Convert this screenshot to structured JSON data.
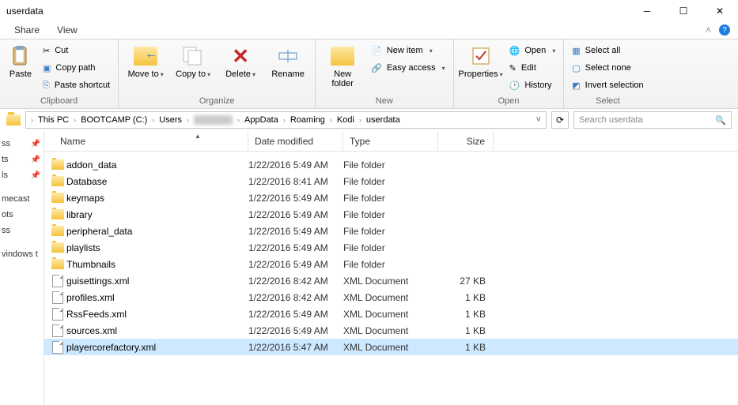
{
  "window": {
    "title": "userdata"
  },
  "tabs": {
    "share": "Share",
    "view": "View"
  },
  "ribbon": {
    "clipboard": {
      "label": "Clipboard",
      "paste": "Paste",
      "cut": "Cut",
      "copy_path": "Copy path",
      "paste_shortcut": "Paste shortcut"
    },
    "organize": {
      "label": "Organize",
      "move_to": "Move\nto",
      "copy_to": "Copy\nto",
      "delete": "Delete",
      "rename": "Rename"
    },
    "new": {
      "label": "New",
      "new_folder": "New\nfolder",
      "new_item": "New item",
      "easy_access": "Easy access"
    },
    "open": {
      "label": "Open",
      "properties": "Properties",
      "open": "Open",
      "edit": "Edit",
      "history": "History"
    },
    "select": {
      "label": "Select",
      "select_all": "Select all",
      "select_none": "Select none",
      "invert": "Invert selection"
    }
  },
  "breadcrumb": {
    "items": [
      "This PC",
      "BOOTCAMP (C:)",
      "Users",
      "████",
      "AppData",
      "Roaming",
      "Kodi",
      "userdata"
    ]
  },
  "search": {
    "placeholder": "Search userdata"
  },
  "columns": {
    "name": "Name",
    "date": "Date modified",
    "type": "Type",
    "size": "Size"
  },
  "nav": {
    "items": [
      "ss",
      "ts",
      "ls",
      "",
      "mecast",
      "ots",
      "ss",
      "",
      "vindows t"
    ]
  },
  "files": [
    {
      "name": "addon_data",
      "date": "1/22/2016 5:49 AM",
      "type": "File folder",
      "size": "",
      "icon": "folder"
    },
    {
      "name": "Database",
      "date": "1/22/2016 8:41 AM",
      "type": "File folder",
      "size": "",
      "icon": "folder"
    },
    {
      "name": "keymaps",
      "date": "1/22/2016 5:49 AM",
      "type": "File folder",
      "size": "",
      "icon": "folder"
    },
    {
      "name": "library",
      "date": "1/22/2016 5:49 AM",
      "type": "File folder",
      "size": "",
      "icon": "folder"
    },
    {
      "name": "peripheral_data",
      "date": "1/22/2016 5:49 AM",
      "type": "File folder",
      "size": "",
      "icon": "folder"
    },
    {
      "name": "playlists",
      "date": "1/22/2016 5:49 AM",
      "type": "File folder",
      "size": "",
      "icon": "folder"
    },
    {
      "name": "Thumbnails",
      "date": "1/22/2016 5:49 AM",
      "type": "File folder",
      "size": "",
      "icon": "folder"
    },
    {
      "name": "guisettings.xml",
      "date": "1/22/2016 8:42 AM",
      "type": "XML Document",
      "size": "27 KB",
      "icon": "xml"
    },
    {
      "name": "profiles.xml",
      "date": "1/22/2016 8:42 AM",
      "type": "XML Document",
      "size": "1 KB",
      "icon": "xml"
    },
    {
      "name": "RssFeeds.xml",
      "date": "1/22/2016 5:49 AM",
      "type": "XML Document",
      "size": "1 KB",
      "icon": "xml"
    },
    {
      "name": "sources.xml",
      "date": "1/22/2016 5:49 AM",
      "type": "XML Document",
      "size": "1 KB",
      "icon": "xml"
    },
    {
      "name": "playercorefactory.xml",
      "date": "1/22/2016 5:47 AM",
      "type": "XML Document",
      "size": "1 KB",
      "icon": "xml",
      "selected": true
    }
  ]
}
